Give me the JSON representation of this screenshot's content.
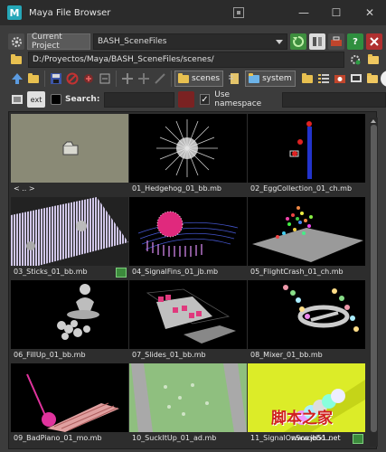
{
  "window": {
    "title": "Maya File Browser",
    "logo_letter": "M",
    "minimize": "—",
    "maximize": "☐",
    "close": "✕"
  },
  "project_row": {
    "settings_icon": "gear-icon",
    "label": "Current Project",
    "project": "BASH_SceneFiles"
  },
  "path_row": {
    "path": "D:/Proyectos/Maya/BASH_SceneFiles/scenes/"
  },
  "nav_row": {
    "tag_scenes": "scenes",
    "tag_system": "system"
  },
  "filter_row": {
    "ext_label": "ext",
    "search_label": "Search:",
    "search_value": "",
    "namespace_label": "Use namespace",
    "namespace_checked": true,
    "namespace_check": "✓"
  },
  "files": [
    {
      "name": "< .. >",
      "kind": "parent-folder"
    },
    {
      "name": "01_Hedgehog_01_bb.mb",
      "kind": "hedgehog"
    },
    {
      "name": "02_EggCollection_01_ch.mb",
      "kind": "eggs"
    },
    {
      "name": "03_Sticks_01_bb.mb",
      "kind": "sticks"
    },
    {
      "name": "04_SignalFins_01_jb.mb",
      "kind": "fins",
      "version_badge": true
    },
    {
      "name": "05_FlightCrash_01_ch.mb",
      "kind": "crash"
    },
    {
      "name": "06_FillUp_01_bb.mb",
      "kind": "fillup"
    },
    {
      "name": "07_Slides_01_bb.mb",
      "kind": "slides"
    },
    {
      "name": "08_Mixer_01_bb.mb",
      "kind": "mixer"
    },
    {
      "name": "09_BadPiano_01_mo.mb",
      "kind": "piano"
    },
    {
      "name": "10_SuckItUp_01_ad.mb",
      "kind": "suck"
    },
    {
      "name": "11_SignalOnSomebo...",
      "kind": "signal",
      "version_badge": true
    }
  ],
  "watermark": {
    "text": "脚本之家",
    "sub": "www.jb51.net"
  },
  "colors": {
    "accent": "#25a7b8",
    "folder": "#e8c050",
    "panel": "#3c3c3c"
  }
}
